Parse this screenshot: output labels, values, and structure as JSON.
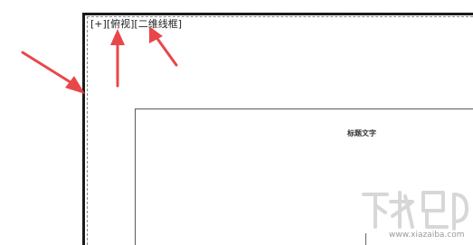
{
  "viewport": {
    "controls": {
      "plus": "[+]",
      "view": "[俯视]",
      "style": "[二维线框]"
    }
  },
  "paper": {
    "title": "标题文字"
  },
  "watermark": {
    "brand": "下载吧",
    "url": "www.xiazaiba.com"
  },
  "colors": {
    "arrow": "#e8474a",
    "frame": "#1a1a1a",
    "dashed_border": "#8a8a8a"
  }
}
